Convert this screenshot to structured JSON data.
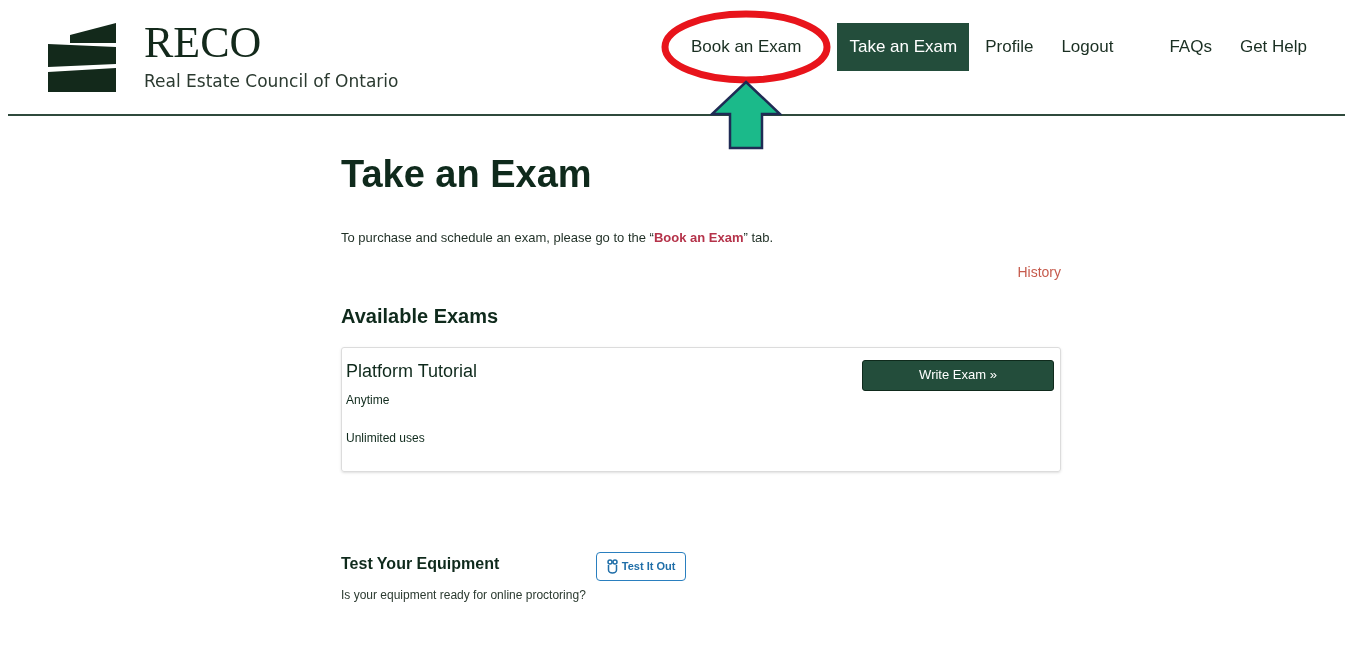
{
  "logo": {
    "name": "RECO",
    "subtitle": "Real Estate Council of Ontario"
  },
  "nav": [
    {
      "label": "Book an Exam",
      "selected": false
    },
    {
      "label": "Take an Exam",
      "selected": true
    },
    {
      "label": "Profile",
      "selected": false
    },
    {
      "label": "Logout",
      "selected": false
    },
    {
      "label": "FAQs",
      "selected": false
    },
    {
      "label": "Get Help",
      "selected": false
    }
  ],
  "page": {
    "title": "Take an Exam",
    "intro": "To purchase and schedule an exam, please go to the “**Book an Exam**” tab.",
    "history_link": "History"
  },
  "available_exams": {
    "heading": "Available Exams",
    "exams": [
      {
        "name": "Platform Tutorial",
        "when": "Anytime",
        "uses": "Unlimited uses",
        "button": "Write Exam »"
      }
    ]
  },
  "equipment": {
    "heading": "Test Your Equipment",
    "text": "Is your equipment ready for online proctoring?",
    "button": "Test It Out"
  }
}
